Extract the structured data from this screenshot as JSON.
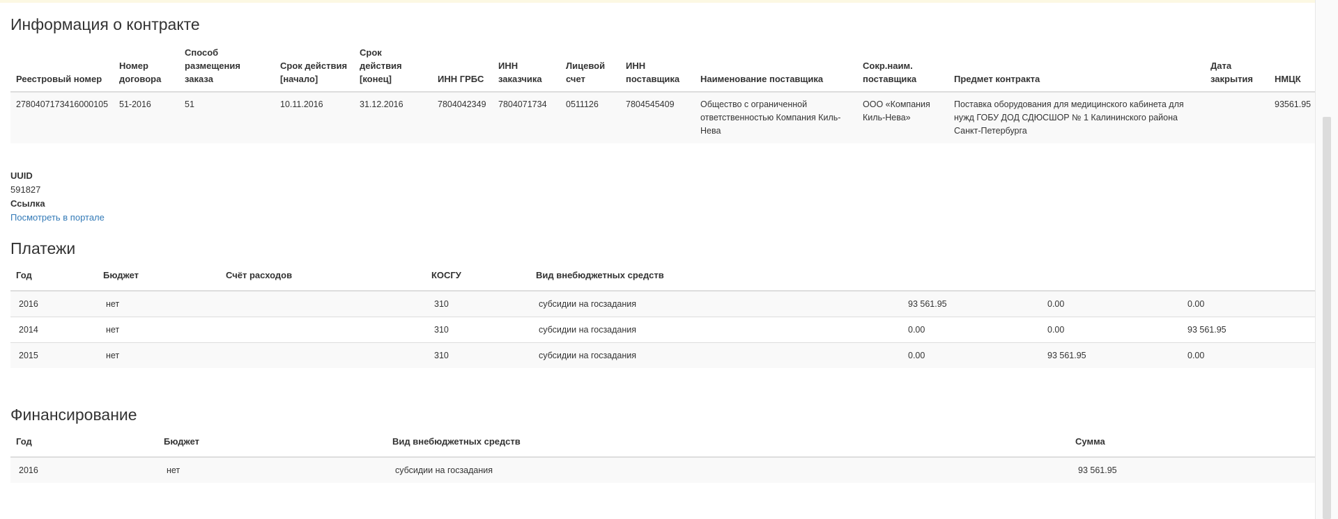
{
  "contract": {
    "heading": "Информация о контракте",
    "columns": [
      "Реестровый номер",
      "Номер договора",
      "Способ размещения заказа",
      "Срок действия [начало]",
      "Срок действия [конец]",
      "ИНН ГРБС",
      "ИНН заказчика",
      "Лицевой счет",
      "ИНН поставщика",
      "Наименование поставщика",
      "Сокр.наим. поставщика",
      "Предмет контракта",
      "Дата закрытия",
      "НМЦК"
    ],
    "row": [
      "2780407173416000105",
      "51-2016",
      "51",
      "10.11.2016",
      "31.12.2016",
      "7804042349",
      "7804071734",
      "0511126",
      "7804545409",
      "Общество с ограниченной ответственностью Компания Киль-Нева",
      "ООО «Компания Киль-Нева»",
      "Поставка оборудования для медицинского кабинета для нужд ГОБУ ДОД СДЮСШОР № 1 Калининского района Санкт-Петербурга",
      "",
      "93561.95"
    ]
  },
  "meta": {
    "uuid_label": "UUID",
    "uuid_value": "591827",
    "link_label": "Ссылка",
    "link_text": "Посмотреть в портале"
  },
  "payments": {
    "heading": "Платежи",
    "columns": [
      "Год",
      "Бюджет",
      "Счёт расходов",
      "КОСГУ",
      "Вид внебюджетных средств",
      "",
      "",
      ""
    ],
    "rows": [
      [
        "2016",
        "нет",
        "",
        "310",
        "субсидии на госзадания",
        "93 561.95",
        "0.00",
        "0.00"
      ],
      [
        "2014",
        "нет",
        "",
        "310",
        "субсидии на госзадания",
        "0.00",
        "0.00",
        "93 561.95"
      ],
      [
        "2015",
        "нет",
        "",
        "310",
        "субсидии на госзадания",
        "0.00",
        "93 561.95",
        "0.00"
      ]
    ]
  },
  "funding": {
    "heading": "Финансирование",
    "columns": [
      "Год",
      "Бюджет",
      "Вид внебюджетных средств",
      "Сумма"
    ],
    "rows": [
      [
        "2016",
        "нет",
        "субсидии на госзадания",
        "93 561.95"
      ]
    ]
  }
}
